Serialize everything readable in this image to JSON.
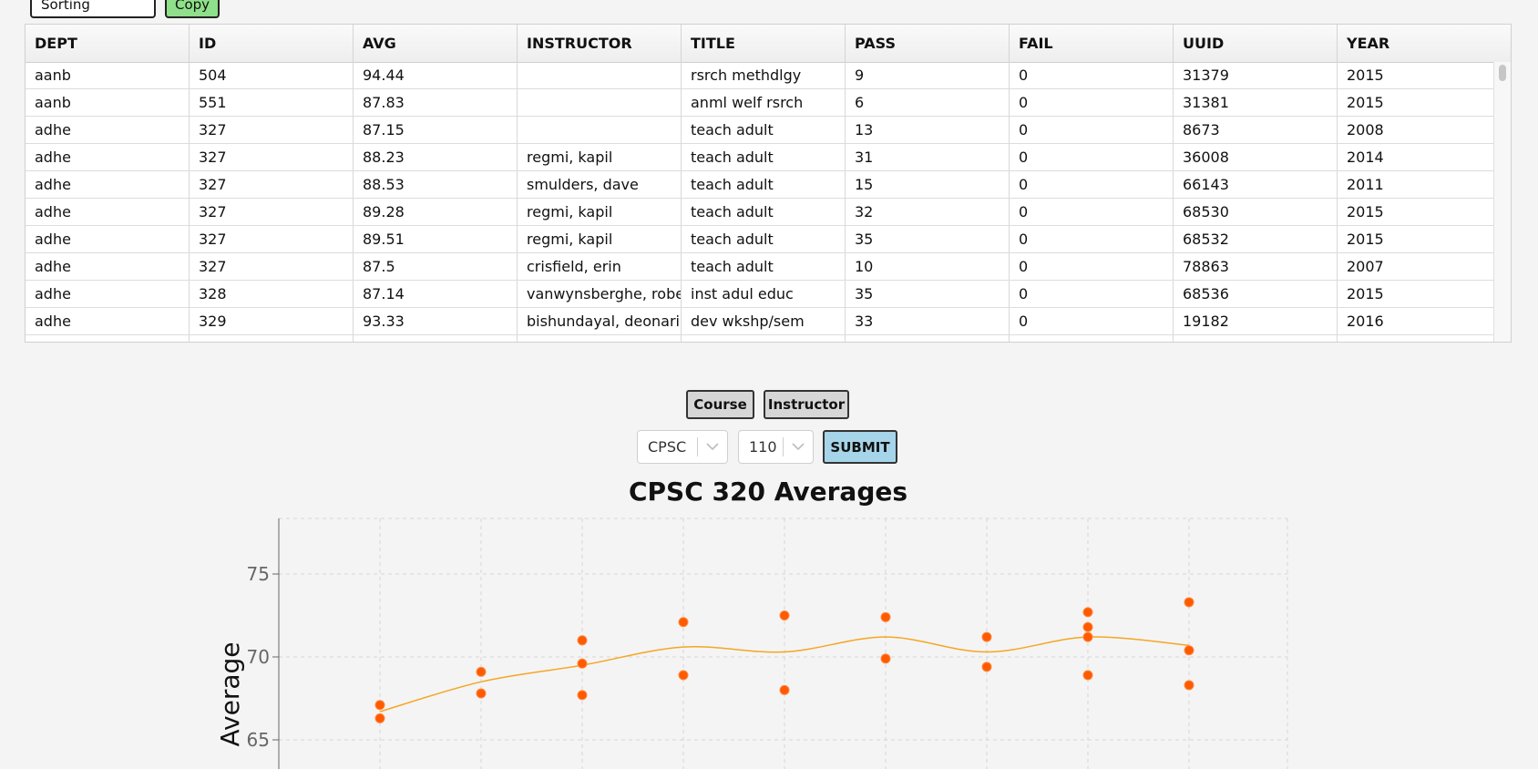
{
  "toolbar": {
    "remove_sorting_label": "Remove Sorting",
    "copy_label": "Copy"
  },
  "table": {
    "headers": [
      "DEPT",
      "ID",
      "AVG",
      "INSTRUCTOR",
      "TITLE",
      "PASS",
      "FAIL",
      "UUID",
      "YEAR"
    ],
    "rows": [
      [
        "aanb",
        "504",
        "94.44",
        "",
        "rsrch methdlgy",
        "9",
        "0",
        "31379",
        "2015"
      ],
      [
        "aanb",
        "551",
        "87.83",
        "",
        "anml welf rsrch",
        "6",
        "0",
        "31381",
        "2015"
      ],
      [
        "adhe",
        "327",
        "87.15",
        "",
        "teach adult",
        "13",
        "0",
        "8673",
        "2008"
      ],
      [
        "adhe",
        "327",
        "88.23",
        "regmi, kapil",
        "teach adult",
        "31",
        "0",
        "36008",
        "2014"
      ],
      [
        "adhe",
        "327",
        "88.53",
        "smulders, dave",
        "teach adult",
        "15",
        "0",
        "66143",
        "2011"
      ],
      [
        "adhe",
        "327",
        "89.28",
        "regmi, kapil",
        "teach adult",
        "32",
        "0",
        "68530",
        "2015"
      ],
      [
        "adhe",
        "327",
        "89.51",
        "regmi, kapil",
        "teach adult",
        "35",
        "0",
        "68532",
        "2015"
      ],
      [
        "adhe",
        "327",
        "87.5",
        "crisfield, erin",
        "teach adult",
        "10",
        "0",
        "78863",
        "2007"
      ],
      [
        "adhe",
        "328",
        "87.14",
        "vanwynsberghe, robert",
        "inst adul educ",
        "35",
        "0",
        "68536",
        "2015"
      ],
      [
        "adhe",
        "329",
        "93.33",
        "bishundayal, deonarine",
        "dev wkshp/sem",
        "33",
        "0",
        "19182",
        "2016"
      ]
    ]
  },
  "mode_buttons": {
    "course_label": "Course",
    "instructor_label": "Instructor"
  },
  "filters": {
    "dept_value": "CPSC",
    "course_value": "110",
    "submit_label": "SUBMIT"
  },
  "chart_data": {
    "type": "scatter",
    "title": "CPSC 320 Averages",
    "ylabel": "Average",
    "xlabel": "",
    "ylim": [
      62.2,
      78.4
    ],
    "y_ticks": [
      65,
      70,
      75
    ],
    "grid": true,
    "point_color": "#ff5a00",
    "trend_color": "#f5a623",
    "points": [
      {
        "x": 0,
        "y": 67.1
      },
      {
        "x": 0,
        "y": 66.3
      },
      {
        "x": 1,
        "y": 69.1
      },
      {
        "x": 1,
        "y": 67.8
      },
      {
        "x": 2,
        "y": 71.0
      },
      {
        "x": 2,
        "y": 69.6
      },
      {
        "x": 2,
        "y": 67.7
      },
      {
        "x": 3,
        "y": 72.1
      },
      {
        "x": 3,
        "y": 68.9
      },
      {
        "x": 4,
        "y": 72.5
      },
      {
        "x": 4,
        "y": 68.0
      },
      {
        "x": 5,
        "y": 72.4
      },
      {
        "x": 5,
        "y": 69.9
      },
      {
        "x": 6,
        "y": 71.2
      },
      {
        "x": 6,
        "y": 69.4
      },
      {
        "x": 7,
        "y": 72.7
      },
      {
        "x": 7,
        "y": 71.8
      },
      {
        "x": 7,
        "y": 71.2
      },
      {
        "x": 7,
        "y": 68.9
      },
      {
        "x": 8,
        "y": 73.3
      },
      {
        "x": 8,
        "y": 70.4
      },
      {
        "x": 8,
        "y": 68.3
      }
    ],
    "trend": [
      66.7,
      68.5,
      69.5,
      70.6,
      70.3,
      71.2,
      70.3,
      71.2,
      70.7
    ]
  }
}
